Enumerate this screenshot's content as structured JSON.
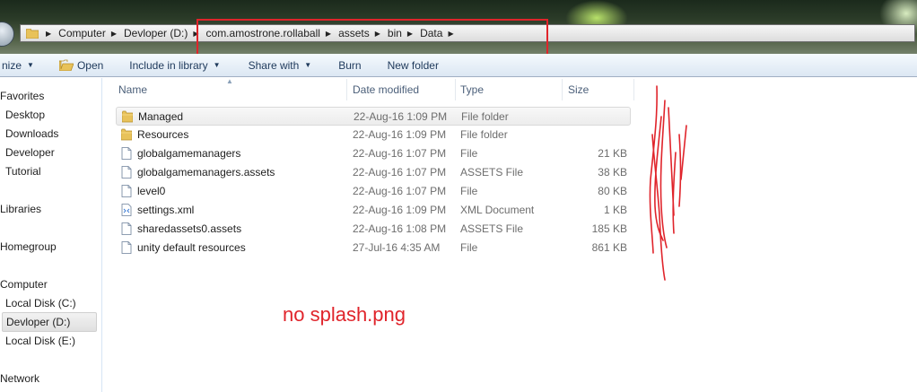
{
  "address": {
    "crumbs": [
      "Computer",
      "Devloper (D:)",
      "com.amostrone.rollaball",
      "assets",
      "bin",
      "Data"
    ]
  },
  "toolbar": {
    "organize": "nize",
    "open": "Open",
    "include_in_library": "Include in library",
    "share_with": "Share with",
    "burn": "Burn",
    "new_folder": "New folder"
  },
  "nav": {
    "favorites": "Favorites",
    "desktop": "Desktop",
    "downloads": "Downloads",
    "developer": "Developer",
    "tutorial": "Tutorial",
    "libraries": "Libraries",
    "homegroup": "Homegroup",
    "computer": "Computer",
    "local_c": "Local Disk (C:)",
    "devloper_d": "Devloper (D:)",
    "local_e": "Local Disk (E:)",
    "network": "Network"
  },
  "columns": {
    "name": "Name",
    "date": "Date modified",
    "type": "Type",
    "size": "Size"
  },
  "files": [
    {
      "name": "Managed",
      "date": "22-Aug-16 1:09 PM",
      "type": "File folder",
      "size": "",
      "icon": "folder-icon"
    },
    {
      "name": "Resources",
      "date": "22-Aug-16 1:09 PM",
      "type": "File folder",
      "size": "",
      "icon": "folder-icon"
    },
    {
      "name": "globalgamemanagers",
      "date": "22-Aug-16 1:07 PM",
      "type": "File",
      "size": "21 KB",
      "icon": "file-icon"
    },
    {
      "name": "globalgamemanagers.assets",
      "date": "22-Aug-16 1:07 PM",
      "type": "ASSETS File",
      "size": "38 KB",
      "icon": "file-icon"
    },
    {
      "name": "level0",
      "date": "22-Aug-16 1:07 PM",
      "type": "File",
      "size": "80 KB",
      "icon": "file-icon"
    },
    {
      "name": "settings.xml",
      "date": "22-Aug-16 1:09 PM",
      "type": "XML Document",
      "size": "1 KB",
      "icon": "xml-file-icon"
    },
    {
      "name": "sharedassets0.assets",
      "date": "22-Aug-16 1:08 PM",
      "type": "ASSETS File",
      "size": "185 KB",
      "icon": "file-icon"
    },
    {
      "name": "unity default resources",
      "date": "27-Jul-16 4:35 AM",
      "type": "File",
      "size": "861 KB",
      "icon": "file-icon"
    }
  ],
  "annotation": {
    "text": "no splash.png",
    "color": "#e0242b"
  }
}
